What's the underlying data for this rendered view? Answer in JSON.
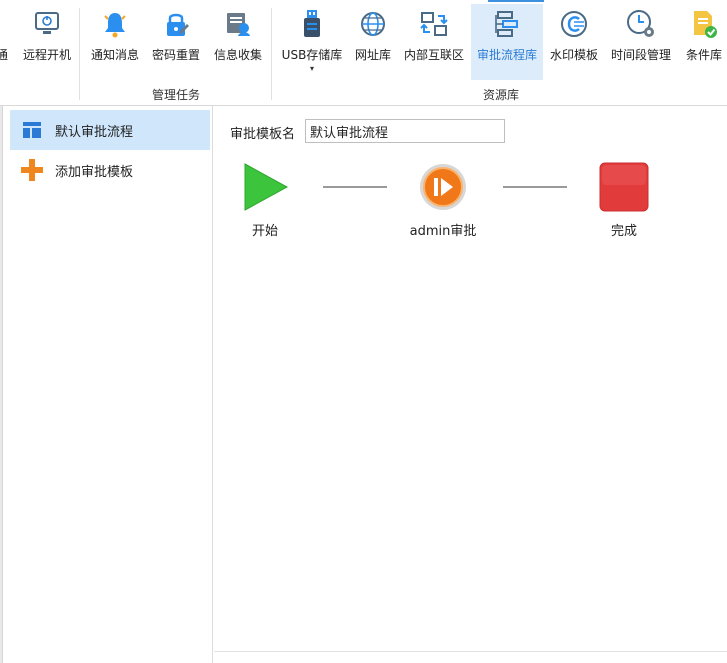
{
  "ribbon": {
    "buttons": [
      {
        "label": "通",
        "icon": "partial-icon"
      },
      {
        "label": "远程开机",
        "icon": "remote-power-icon"
      },
      {
        "label": "通知消息",
        "icon": "bell-icon"
      },
      {
        "label": "密码重置",
        "icon": "password-lock-icon"
      },
      {
        "label": "信息收集",
        "icon": "info-collect-icon"
      },
      {
        "label": "USB存储库",
        "icon": "usb-icon",
        "has_dropdown": true,
        "dropdown_glyph": "▾"
      },
      {
        "label": "网址库",
        "icon": "globe-icon"
      },
      {
        "label": "内部互联区",
        "icon": "network-icon"
      },
      {
        "label": "审批流程库",
        "icon": "flowchart-icon",
        "active": true
      },
      {
        "label": "水印模板",
        "icon": "watermark-icon"
      },
      {
        "label": "时间段管理",
        "icon": "clock-gear-icon"
      },
      {
        "label": "条件库",
        "icon": "condition-doc-icon"
      }
    ],
    "groups": {
      "manage_tasks": "管理任务",
      "resources": "资源库"
    },
    "colors": {
      "accent": "#2b7bd6",
      "active_bg": "#dcecfa"
    }
  },
  "sidebar": {
    "items": [
      {
        "label": "默认审批流程",
        "icon": "template-layout-icon",
        "selected": true
      },
      {
        "label": "添加审批模板",
        "icon": "plus-icon",
        "selected": false
      }
    ]
  },
  "main": {
    "template_name_label": "审批模板名",
    "template_name_value": "默认审批流程",
    "flow": {
      "nodes": [
        {
          "label": "开始",
          "icon": "play-triangle-icon",
          "color": "#3dc43d"
        },
        {
          "label": "admin审批",
          "icon": "approve-circle-icon",
          "color": "#f07818"
        },
        {
          "label": "完成",
          "icon": "stop-square-icon",
          "color": "#e23b3b"
        }
      ]
    }
  }
}
